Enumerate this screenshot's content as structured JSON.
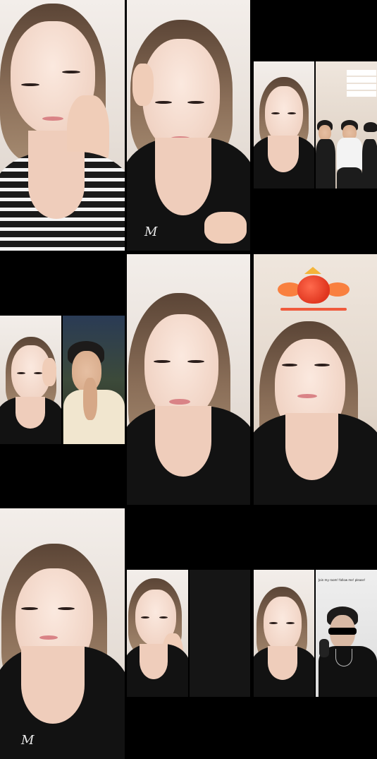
{
  "grid": {
    "tiles": [
      {
        "id": "tile-1",
        "kind": "solo"
      },
      {
        "id": "tile-2",
        "kind": "solo"
      },
      {
        "id": "tile-3",
        "kind": "split"
      },
      {
        "id": "tile-4",
        "kind": "split"
      },
      {
        "id": "tile-5",
        "kind": "solo"
      },
      {
        "id": "tile-6",
        "kind": "solo-sticker"
      },
      {
        "id": "tile-7",
        "kind": "solo"
      },
      {
        "id": "tile-8",
        "kind": "split"
      },
      {
        "id": "tile-9",
        "kind": "split"
      }
    ]
  },
  "overlays": {
    "tile3_list": [
      "",
      "",
      "",
      ""
    ],
    "tile6_banner_lines": [
      "",
      ""
    ],
    "tile9_caption": "Join my room! follow me! please!"
  },
  "shirt_logo": "M",
  "colors": {
    "background": "#000000",
    "sticker_red": "#e0361f",
    "sticker_orange": "#f9803f",
    "crown_gold": "#f4b43a"
  }
}
